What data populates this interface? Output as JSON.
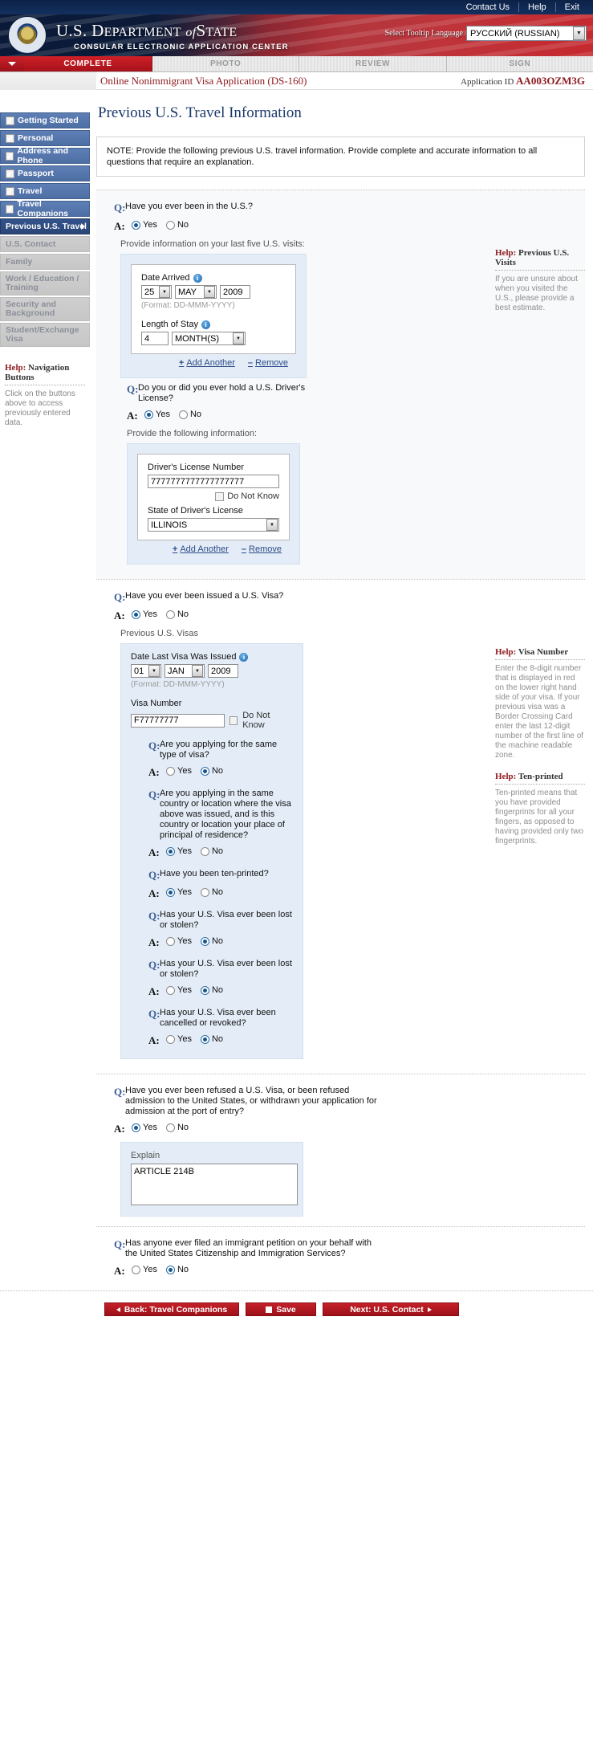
{
  "topbar": {
    "links": [
      "Contact Us",
      "Help",
      "Exit"
    ]
  },
  "banner": {
    "line1_a": "U.S. D",
    "line1_b": "EPARTMENT",
    "line1_c": "of",
    "line1_d": "S",
    "line1_e": "TATE",
    "line2": "CONSULAR ELECTRONIC APPLICATION CENTER",
    "language_label": "Select Tooltip Language",
    "language_value": "РУССКИЙ (RUSSIAN)",
    "seal_icon": "us-dos-seal-icon"
  },
  "steps": [
    {
      "label": "COMPLETE",
      "active": true
    },
    {
      "label": "PHOTO",
      "active": false
    },
    {
      "label": "REVIEW",
      "active": false
    },
    {
      "label": "SIGN",
      "active": false
    }
  ],
  "apphead": {
    "title": "Online Nonimmigrant Visa Application (DS-160)",
    "appid_label": "Application ID",
    "appid_value": "AA003OZM3G"
  },
  "sidebar": {
    "items": [
      {
        "label": "Getting Started",
        "state": "done"
      },
      {
        "label": "Personal",
        "state": "done"
      },
      {
        "label": "Address and Phone",
        "state": "done"
      },
      {
        "label": "Passport",
        "state": "done"
      },
      {
        "label": "Travel",
        "state": "done"
      },
      {
        "label": "Travel Companions",
        "state": "done"
      },
      {
        "label": "Previous U.S. Travel",
        "state": "current"
      },
      {
        "label": "U.S. Contact",
        "state": "disabled"
      },
      {
        "label": "Family",
        "state": "disabled"
      },
      {
        "label": "Work / Education / Training",
        "state": "disabled"
      },
      {
        "label": "Security and Background",
        "state": "disabled"
      },
      {
        "label": "Student/Exchange Visa",
        "state": "disabled"
      }
    ],
    "help": {
      "header_label": "Help:",
      "header_topic": "Navigation Buttons",
      "text": "Click on the buttons above to access previously entered data."
    }
  },
  "main": {
    "page_title": "Previous U.S. Travel Information",
    "note": "NOTE: Provide the following previous U.S. travel information. Provide complete and accurate information to all questions that require an explanation.",
    "q_mark": "Q:",
    "a_mark": "A:",
    "yes": "Yes",
    "no": "No",
    "add_another": "Add Another",
    "remove": "Remove",
    "plus": "+",
    "minus": "–",
    "do_not_know": "Do Not Know",
    "format_hint": "(Format: DD-MMM-YYYY)",
    "s1": {
      "question": "Have you ever been in the U.S.?",
      "answer": "Yes",
      "subnote": "Provide information on your last five U.S. visits:",
      "date_arrived_label": "Date Arrived",
      "date_day": "25",
      "date_month": "MAY",
      "date_year": "2009",
      "length_label": "Length of Stay",
      "length_value": "4",
      "length_unit": "MONTH(S)"
    },
    "s1_help": {
      "header_label": "Help:",
      "header_topic": "Previous U.S. Visits",
      "text": "If you are unsure about when you visited the U.S., please provide a best estimate."
    },
    "s2": {
      "question": "Do you or did you ever hold a U.S. Driver's License?",
      "answer": "Yes",
      "subnote": "Provide the following information:",
      "dl_label": "Driver's License Number",
      "dl_value": "7777777777777777777",
      "state_label": "State of Driver's License",
      "state_value": "ILLINOIS"
    },
    "s3": {
      "question": "Have you ever been issued a U.S. Visa?",
      "answer": "Yes",
      "panel_title": "Previous U.S. Visas",
      "date_label": "Date Last Visa Was Issued",
      "date_day": "01",
      "date_month": "JAN",
      "date_year": "2009",
      "visa_number_label": "Visa Number",
      "visa_number_value": "F77777777",
      "sub_questions": [
        {
          "question": "Are you applying for the same type of visa?",
          "answer": "No"
        },
        {
          "question": "Are you applying in the same country or location where the visa above was issued, and is this country or location your place of principal of residence?",
          "answer": "Yes"
        },
        {
          "question": "Have you been ten-printed?",
          "answer": "Yes"
        },
        {
          "question": "Has your U.S. Visa ever been lost or stolen?",
          "answer": "No"
        },
        {
          "question": "Has your U.S. Visa ever been lost or stolen?",
          "answer": "No"
        },
        {
          "question": "Has your U.S. Visa ever been cancelled or revoked?",
          "answer": "No"
        }
      ]
    },
    "s3_help1": {
      "header_label": "Help:",
      "header_topic": "Visa Number",
      "text": "Enter the 8-digit number that is displayed in red on the lower right hand side of your visa. If your previous visa was a Border Crossing Card enter the last 12-digit number of the first line of the machine readable zone."
    },
    "s3_help2": {
      "header_label": "Help:",
      "header_topic": "Ten-printed",
      "text": "Ten-printed means that you have provided fingerprints for all your fingers, as opposed to having provided only two fingerprints."
    },
    "s4": {
      "question": "Have you ever been refused a U.S. Visa, or been refused admission to the United States, or withdrawn your application for admission at the port of entry?",
      "answer": "Yes",
      "explain_label": "Explain",
      "explain_value": "ARTICLE 214B"
    },
    "s5": {
      "question": "Has anyone ever filed an immigrant petition on your behalf with the United States Citizenship and Immigration Services?",
      "answer": "No"
    }
  },
  "footer": {
    "back": "Back: Travel Companions",
    "save": "Save",
    "next": "Next: U.S. Contact",
    "save_icon": "floppy-disk-icon",
    "back_icon": "triangle-left-icon",
    "next_icon": "triangle-right-icon"
  }
}
